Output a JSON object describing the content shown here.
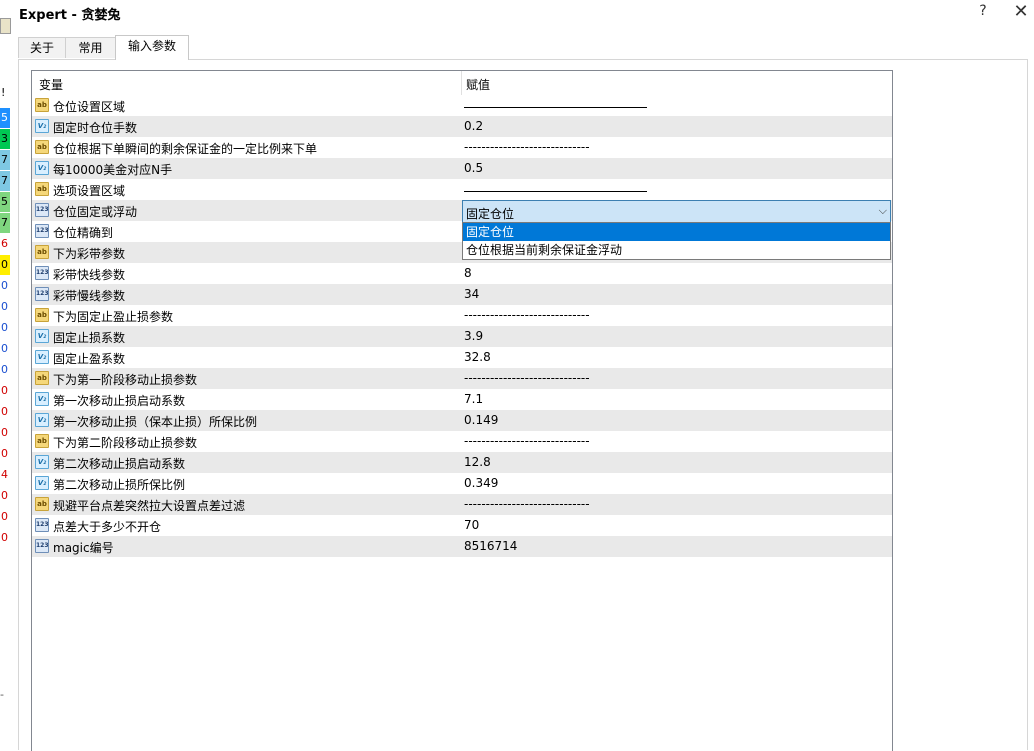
{
  "window": {
    "title": "Expert - 贪婪兔",
    "help_glyph": "?",
    "close_glyph": "✕"
  },
  "left_strip": {
    "glyph_top": "!",
    "cells": [
      {
        "text": "5",
        "bg": "#1e90ff",
        "fg": "#ffffff"
      },
      {
        "text": "3",
        "bg": "#00c853",
        "fg": "#000000"
      },
      {
        "text": "7",
        "bg": "#7ec8e3",
        "fg": "#000000"
      },
      {
        "text": "7",
        "bg": "#7ec8e3",
        "fg": "#000000"
      },
      {
        "text": "5",
        "bg": "#7fd67f",
        "fg": "#000000"
      },
      {
        "text": "7",
        "bg": "#7fd67f",
        "fg": "#000000"
      },
      {
        "text": "6",
        "bg": "#ffffff",
        "fg": "#d00000"
      },
      {
        "text": "0",
        "bg": "#ffee00",
        "fg": "#000000"
      },
      {
        "text": "0",
        "bg": "#ffffff",
        "fg": "#1a4fd0"
      },
      {
        "text": "0",
        "bg": "#ffffff",
        "fg": "#1a4fd0"
      },
      {
        "text": "0",
        "bg": "#ffffff",
        "fg": "#1a4fd0"
      },
      {
        "text": "0",
        "bg": "#ffffff",
        "fg": "#1a4fd0"
      },
      {
        "text": "0",
        "bg": "#ffffff",
        "fg": "#1a4fd0"
      },
      {
        "text": "0",
        "bg": "#ffffff",
        "fg": "#d00000"
      },
      {
        "text": "0",
        "bg": "#ffffff",
        "fg": "#d00000"
      },
      {
        "text": "0",
        "bg": "#ffffff",
        "fg": "#d00000"
      },
      {
        "text": "0",
        "bg": "#ffffff",
        "fg": "#d00000"
      },
      {
        "text": "4",
        "bg": "#ffffff",
        "fg": "#d00000"
      },
      {
        "text": "0",
        "bg": "#ffffff",
        "fg": "#d00000"
      },
      {
        "text": "0",
        "bg": "#ffffff",
        "fg": "#d00000"
      },
      {
        "text": "0",
        "bg": "#ffffff",
        "fg": "#d00000"
      }
    ],
    "dash": "-"
  },
  "tabs": [
    {
      "label": "关于",
      "active": false
    },
    {
      "label": "常用",
      "active": false
    },
    {
      "label": "输入参数",
      "active": true
    }
  ],
  "grid": {
    "col_variable": "变量",
    "col_value": "赋值",
    "rows": [
      {
        "type": "ab",
        "name": "仓位设置区域",
        "value": "",
        "line": true
      },
      {
        "type": "v2",
        "name": "固定时仓位手数",
        "value": "0.2"
      },
      {
        "type": "ab",
        "name": "仓位根据下单瞬间的剩余保证金的一定比例来下单",
        "value": "-----------------------------"
      },
      {
        "type": "v2",
        "name": "每10000美金对应N手",
        "value": "0.5"
      },
      {
        "type": "ab",
        "name": "选项设置区域",
        "value": "",
        "line": true
      },
      {
        "type": "n123",
        "name": "仓位固定或浮动",
        "value": "固定仓位",
        "combo": true
      },
      {
        "type": "n123",
        "name": "仓位精确到",
        "value": ""
      },
      {
        "type": "ab",
        "name": "下为彩带参数",
        "value": ""
      },
      {
        "type": "n123",
        "name": "彩带快线参数",
        "value": "8"
      },
      {
        "type": "n123",
        "name": "彩带慢线参数",
        "value": "34"
      },
      {
        "type": "ab",
        "name": "下为固定止盈止损参数",
        "value": "-----------------------------"
      },
      {
        "type": "v2",
        "name": "固定止损系数",
        "value": "3.9"
      },
      {
        "type": "v2",
        "name": "固定止盈系数",
        "value": "32.8"
      },
      {
        "type": "ab",
        "name": "下为第一阶段移动止损参数",
        "value": "-----------------------------"
      },
      {
        "type": "v2",
        "name": "第一次移动止损启动系数",
        "value": "7.1"
      },
      {
        "type": "v2",
        "name": "第一次移动止损（保本止损）所保比例",
        "value": "0.149"
      },
      {
        "type": "ab",
        "name": "下为第二阶段移动止损参数",
        "value": "-----------------------------"
      },
      {
        "type": "v2",
        "name": "第二次移动止损启动系数",
        "value": "12.8"
      },
      {
        "type": "v2",
        "name": "第二次移动止损所保比例",
        "value": "0.349"
      },
      {
        "type": "ab",
        "name": "规避平台点差突然拉大设置点差过滤",
        "value": "-----------------------------"
      },
      {
        "type": "n123",
        "name": "点差大于多少不开仓",
        "value": "70"
      },
      {
        "type": "n123",
        "name": "magic编号",
        "value": "8516714"
      }
    ],
    "dropdown_options": [
      "固定仓位",
      "仓位根据当前剩余保证金浮动"
    ],
    "dropdown_selected": 0
  },
  "icon_glyphs": {
    "ab": "ab",
    "v2": "V₂",
    "n123": "123"
  },
  "colors": {
    "selection": "#0078d7",
    "combo_bg": "#cce4f7",
    "alt_row": "#e9e9e9"
  }
}
